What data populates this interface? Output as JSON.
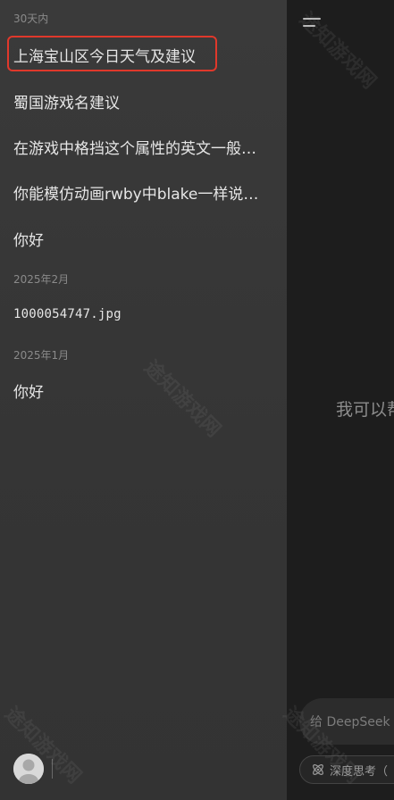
{
  "drawer": {
    "sections": [
      {
        "label": "30天内",
        "items": [
          {
            "title": "上海宝山区今日天气及建议",
            "highlighted": true
          },
          {
            "title": "蜀国游戏名建议"
          },
          {
            "title": "在游戏中格挡这个属性的英文一般…"
          },
          {
            "title": "你能模仿动画rwby中blake一样说…"
          },
          {
            "title": "你好"
          }
        ]
      },
      {
        "label": "2025年2月",
        "items": [
          {
            "title": "1000054747.jpg"
          }
        ]
      },
      {
        "label": "2025年1月",
        "items": [
          {
            "title": "你好"
          }
        ]
      }
    ],
    "footer": {
      "avatar_icon": "user-avatar-icon"
    }
  },
  "main": {
    "menu_icon": "menu-icon",
    "welcome_text": "我可以帮",
    "input_placeholder": "给 DeepSeek",
    "deep_think_label": "深度思考（",
    "deep_think_icon": "atom-icon"
  },
  "watermark_text": "途知游戏网",
  "colors": {
    "highlight_border": "#e0382b",
    "drawer_bg": "#383838",
    "main_bg": "#1d1d1d"
  }
}
